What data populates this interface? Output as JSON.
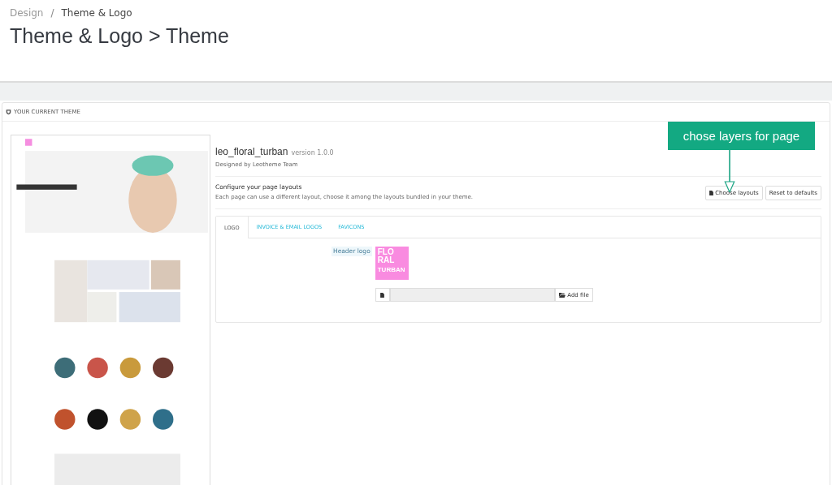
{
  "breadcrumb_separator": "/",
  "breadcrumb": [
    {
      "label": "Design",
      "current": false
    },
    {
      "label": "Theme & Logo",
      "current": true
    }
  ],
  "page_title": "Theme & Logo > Theme",
  "panel": {
    "heading": "YOUR CURRENT THEME",
    "theme": {
      "name": "leo_floral_turban",
      "version": "version 1.0.0",
      "author": "Designed by Leotheme Team"
    },
    "layouts": {
      "title": "Configure your page layouts",
      "description": "Each page can use a different layout, choose it among the layouts bundled in your theme.",
      "buttons": [
        {
          "label": "Choose layouts",
          "kind": "icon"
        },
        {
          "label": "Reset to defaults",
          "kind": "plain"
        }
      ]
    },
    "tabs": [
      {
        "label": "LOGO",
        "selected": true
      },
      {
        "label": "INVOICE & EMAIL LOGOS",
        "selected": false
      },
      {
        "label": "FAVICONS",
        "selected": false
      }
    ],
    "logo_field": {
      "label": "Header logo",
      "logo_lines": [
        "FLO",
        "RAL",
        "TURBAN"
      ],
      "upload_button": "Add file"
    }
  },
  "callout": {
    "text": "chose layers for page"
  }
}
